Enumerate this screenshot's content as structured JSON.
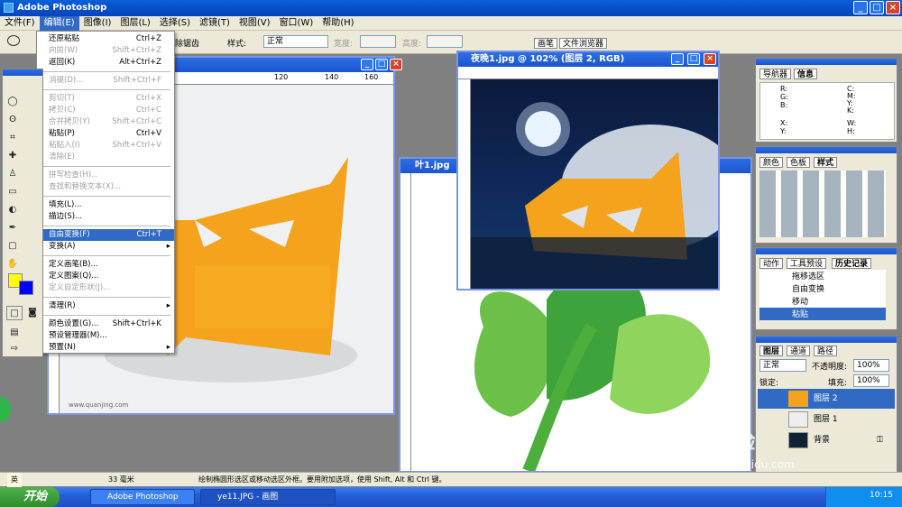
{
  "app": {
    "title": "Adobe Photoshop"
  },
  "menubar": {
    "items": [
      "文件(F)",
      "编辑(E)",
      "图像(I)",
      "图层(L)",
      "选择(S)",
      "滤镜(T)",
      "视图(V)",
      "窗口(W)",
      "帮助(H)"
    ]
  },
  "options": {
    "anti_alias": "除锯齿",
    "style_label": "样式:",
    "style_value": "正常",
    "width_label": "宽度:",
    "height_label": "高度:",
    "tab_brush": "画笔",
    "tab_browser": "文件浏览器"
  },
  "edit_menu": {
    "items": [
      {
        "label": "还原粘贴",
        "shortcut": "Ctrl+Z",
        "enabled": true
      },
      {
        "label": "向前(W)",
        "shortcut": "Shift+Ctrl+Z",
        "enabled": false
      },
      {
        "label": "返回(K)",
        "shortcut": "Alt+Ctrl+Z",
        "enabled": true
      },
      {
        "label": "消褪(D)...",
        "shortcut": "Shift+Ctrl+F",
        "enabled": false
      },
      {
        "label": "剪切(T)",
        "shortcut": "Ctrl+X",
        "enabled": false
      },
      {
        "label": "拷贝(C)",
        "shortcut": "Ctrl+C",
        "enabled": false
      },
      {
        "label": "合并拷贝(Y)",
        "shortcut": "Shift+Ctrl+C",
        "enabled": false
      },
      {
        "label": "粘贴(P)",
        "shortcut": "Ctrl+V",
        "enabled": true
      },
      {
        "label": "粘贴入(I)",
        "shortcut": "Shift+Ctrl+V",
        "enabled": false
      },
      {
        "label": "清除(E)",
        "shortcut": "",
        "enabled": false
      },
      {
        "label": "拼写检查(H)...",
        "shortcut": "",
        "enabled": false
      },
      {
        "label": "查找和替换文本(X)...",
        "shortcut": "",
        "enabled": false
      },
      {
        "label": "填充(L)...",
        "shortcut": "",
        "enabled": true
      },
      {
        "label": "描边(S)...",
        "shortcut": "",
        "enabled": true
      },
      {
        "label": "自由变换(F)",
        "shortcut": "Ctrl+T",
        "enabled": true,
        "highlighted": true
      },
      {
        "label": "变换(A)",
        "shortcut": "",
        "enabled": true,
        "submenu": true
      },
      {
        "label": "定义画笔(B)...",
        "shortcut": "",
        "enabled": true
      },
      {
        "label": "定义图案(Q)...",
        "shortcut": "",
        "enabled": true
      },
      {
        "label": "定义自定形状(J)...",
        "shortcut": "",
        "enabled": false
      },
      {
        "label": "清理(R)",
        "shortcut": "",
        "enabled": true,
        "submenu": true
      },
      {
        "label": "颜色设置(G)...",
        "shortcut": "Shift+Ctrl+K",
        "enabled": true
      },
      {
        "label": "预设管理器(M)...",
        "shortcut": "",
        "enabled": true
      },
      {
        "label": "预置(N)",
        "shortcut": "",
        "enabled": true,
        "submenu": true
      }
    ]
  },
  "documents": {
    "night": {
      "title": "夜晚1.jpg @ 102% (图层 2, RGB)"
    },
    "leaf": {
      "title": "叶1.jpg"
    },
    "watermark": "www.quanjing.com"
  },
  "ruler_labels": [
    "120",
    "140",
    "160"
  ],
  "panels": {
    "navigator": {
      "tabs": [
        "导航器",
        "信息"
      ],
      "labels": [
        "R:",
        "G:",
        "B:",
        "C:",
        "M:",
        "Y:",
        "K:",
        "X:",
        "Y:",
        "W:",
        "H:"
      ]
    },
    "color": {
      "tabs": [
        "颜色",
        "色板",
        "样式"
      ]
    },
    "history": {
      "tabs": [
        "动作",
        "工具预设",
        "历史记录"
      ],
      "items": [
        "拖移选区",
        "自由变换",
        "移动",
        "粘贴"
      ]
    },
    "layers": {
      "tabs": [
        "图层",
        "通道",
        "路径"
      ],
      "blend": "正常",
      "opacity_label": "不透明度:",
      "opacity": "100%",
      "lock_label": "锁定:",
      "fill_label": "填充:",
      "fill": "100%",
      "layers": [
        "图层 2",
        "图层 1",
        "背景"
      ]
    }
  },
  "status": {
    "zoom": "33 毫米",
    "hint": "绘制椭圆形选区或移动选区外框。要用附加选项，使用 Shift, Alt 和 Ctrl 键。",
    "ime": "英"
  },
  "taskbar": {
    "start": "开始",
    "items": [
      "Adobe Photoshop",
      "ye11.JPG - 画图"
    ],
    "clock": "10:15"
  },
  "watermark": {
    "baidu": "Bai",
    "baidu2": "经验",
    "site": "jingyan.baidu.com"
  },
  "colors": {
    "foreground": "#ffff00",
    "background": "#0000ff",
    "menu_highlight": "#316ac5"
  }
}
